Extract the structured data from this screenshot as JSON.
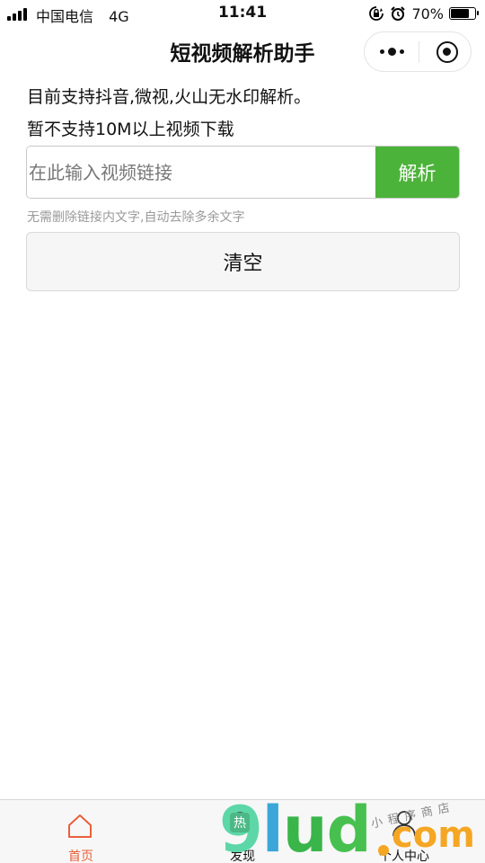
{
  "status_bar": {
    "carrier": "中国电信",
    "network": "4G",
    "time": "11:41",
    "battery": "70%",
    "battery_level": 0.7
  },
  "nav": {
    "title": "短视频解析助手"
  },
  "intro": {
    "line1": "目前支持抖音,微视,火山无水印解析。",
    "line2": "暂不支持10M以上视频下载"
  },
  "search": {
    "placeholder": "在此输入视频链接",
    "value": "",
    "button_label": "解析"
  },
  "hint": "无需删除链接内文字,自动去除多余文字",
  "clear_label": "清空",
  "tabs": [
    {
      "label": "首页",
      "icon": "home-icon",
      "active": true
    },
    {
      "label": "发现",
      "icon": "discover-icon",
      "active": false
    },
    {
      "label": "个人中心",
      "icon": "profile-icon",
      "active": false
    }
  ],
  "watermark": {
    "brand": "9lud",
    "suffix": "com",
    "tagline": "小程序商店",
    "badge": "热"
  },
  "colors": {
    "accent_green": "#4cb33a",
    "active_tab": "#e8603c"
  }
}
